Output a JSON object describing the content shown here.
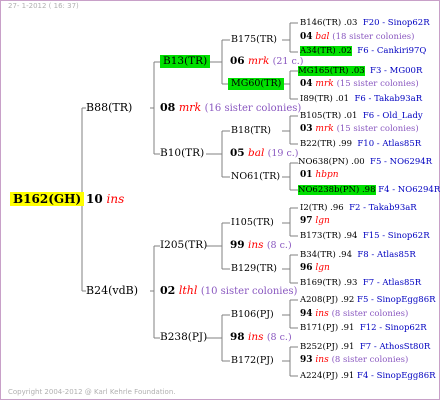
{
  "header": "27-  1-2012 ( 16: 37)",
  "footer": "Copyright 2004-2012 @ Karl Kehrle Foundation.",
  "root": {
    "label": "B162(GH)",
    "highlight": "#ffff00",
    "prog_num": "10",
    "prog_mark": "ins"
  },
  "gen2": [
    {
      "label": "B88(TR)",
      "prog_num": "08",
      "prog_mark": "mrk",
      "prog_sis": "(16 sister colonies)"
    },
    {
      "label": "B24(vdB)",
      "prog_num": "02",
      "prog_mark": "lthl",
      "prog_sis": "(10 sister colonies)"
    }
  ],
  "gen3": [
    {
      "label": "B13(TR)",
      "highlight": "#00e000",
      "prog_num": "06",
      "prog_mark": "mrk",
      "prog_sis": "(21 c.)"
    },
    {
      "label": "B10(TR)",
      "prog_num": "05",
      "prog_mark": "bal",
      "prog_sis": "(19 c.)"
    },
    {
      "label": "I205(TR)",
      "prog_num": "99",
      "prog_mark": "ins",
      "prog_sis": "(8 c.)"
    },
    {
      "label": "B238(PJ)",
      "prog_num": "98",
      "prog_mark": "ins",
      "prog_sis": "(8 c.)"
    }
  ],
  "gen4": [
    {
      "label": "B175(TR)",
      "prog_num": "04",
      "prog_mark": "bal",
      "prog_sis": "(18 sister colonies)"
    },
    {
      "label": "MG60(TR)",
      "highlight": "#00e000",
      "prog_num": "04",
      "prog_mark": "mrk",
      "prog_sis": "(15 sister colonies)"
    },
    {
      "label": "B18(TR)",
      "prog_num": "03",
      "prog_mark": "mrk",
      "prog_sis": "(15 sister colonies)"
    },
    {
      "label": "NO61(TR)",
      "prog_num": "01",
      "prog_mark": "hbpn",
      "prog_sis": ""
    },
    {
      "label": "I105(TR)",
      "prog_num": "97",
      "prog_mark": "lgn",
      "prog_sis": ""
    },
    {
      "label": "B129(TR)",
      "prog_num": "96",
      "prog_mark": "lgn",
      "prog_sis": ""
    },
    {
      "label": "B106(PJ)",
      "prog_num": "94",
      "prog_mark": "ins",
      "prog_sis": "(8 sister colonies)"
    },
    {
      "label": "B172(PJ)",
      "prog_num": "93",
      "prog_mark": "ins",
      "prog_sis": "(8 sister colonies)"
    }
  ],
  "gen5": [
    {
      "name": "B146(TR) .03",
      "id": "F20 - Sinop62R"
    },
    {
      "name": "A34(TR) .02",
      "id": "F6 - Cankiri97Q",
      "highlight": "#00e000"
    },
    {
      "name": "MG165(TR) .03",
      "id": "F3 - MG00R",
      "highlight": "#00e000"
    },
    {
      "name": "I89(TR) .01",
      "id": "F6 - Takab93aR"
    },
    {
      "name": "B105(TR) .01",
      "id": "F6 - Old_Lady"
    },
    {
      "name": "B22(TR) .99",
      "id": "F10 - Atlas85R"
    },
    {
      "name": "NO638(PN) .00",
      "id": "F5 - NO6294R"
    },
    {
      "name": "NO6238b(PN) .98",
      "id": "F4 - NO6294R",
      "highlight": "#00e000"
    },
    {
      "name": "I2(TR) .96",
      "id": "F2 - Takab93aR"
    },
    {
      "name": "B173(TR) .94",
      "id": "F15 - Sinop62R"
    },
    {
      "name": "B34(TR) .94",
      "id": "F8 - Atlas85R"
    },
    {
      "name": "B169(TR) .93",
      "id": "F7 - Atlas85R"
    },
    {
      "name": "A208(PJ) .92",
      "id": "F5 - SinopEgg86R"
    },
    {
      "name": "B171(PJ) .91",
      "id": "F12 - Sinop62R"
    },
    {
      "name": "B252(PJ) .91",
      "id": "F7 - AthosSt80R"
    },
    {
      "name": "A224(PJ) .91",
      "id": "F4 - SinopEgg86R"
    }
  ]
}
